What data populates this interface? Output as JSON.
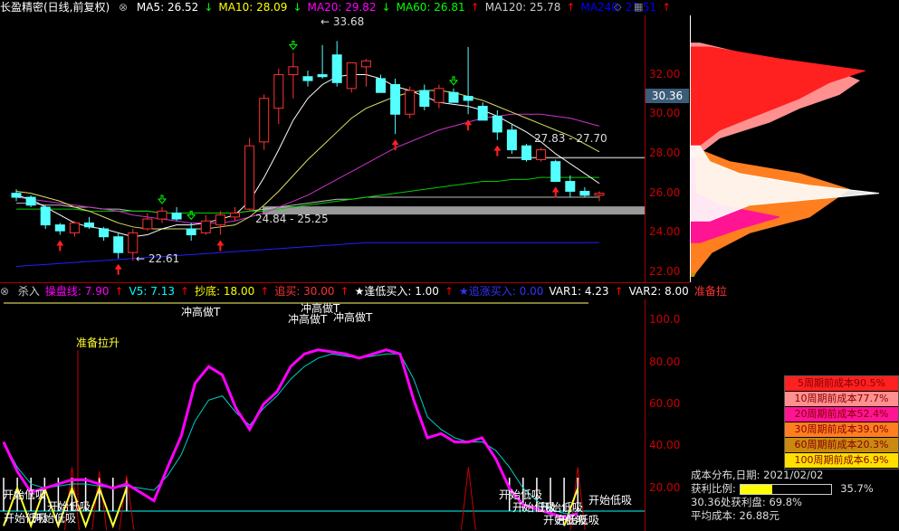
{
  "header": {
    "title": "长盈精密(日线,前复权)",
    "ma": [
      {
        "label": "MA5: 26.52",
        "arrow": "↓",
        "color": "#ffffff",
        "arrow_color": "#00ff00"
      },
      {
        "label": "MA10: 28.09",
        "arrow": "↓",
        "color": "#ffff00",
        "arrow_color": "#00ff00"
      },
      {
        "label": "MA20: 29.82",
        "arrow": "↓",
        "color": "#ff00ff",
        "arrow_color": "#00ff00"
      },
      {
        "label": "MA60: 26.81",
        "arrow": "↑",
        "color": "#00ff00",
        "arrow_color": "#ff0000"
      },
      {
        "label": "MA120: 25.78",
        "arrow": "↑",
        "color": "#cccccc",
        "arrow_color": "#ff0000"
      },
      {
        "label": "MA240: 23.51",
        "arrow": "↑",
        "color": "#0000ff",
        "arrow_color": "#ff0000"
      }
    ]
  },
  "indicator_header": {
    "items": [
      {
        "label": "杀入",
        "color": "#cccccc"
      },
      {
        "label": "操盘线: 7.90",
        "color": "#ff00ff",
        "arrow": "↑",
        "arrow_color": "#ff0000"
      },
      {
        "label": "V5: 7.13",
        "color": "#00ffff",
        "arrow": "↑",
        "arrow_color": "#ff0000"
      },
      {
        "label": "抄底: 18.00",
        "color": "#ffff00",
        "arrow": "↑",
        "arrow_color": "#ff0000"
      },
      {
        "label": "追买: 30.00",
        "color": "#ff3333",
        "arrow": "↑",
        "arrow_color": "#ff0000"
      },
      {
        "label": "★逢低买入: 1.00",
        "color": "#ffffff",
        "arrow": "↑",
        "arrow_color": "#ff0000"
      },
      {
        "label": "★追涨买入: 0.00",
        "color": "#3333ff",
        "arrow": "",
        "arrow_color": "#ff0000"
      },
      {
        "label": "VAR1: 4.23",
        "color": "#ffffff",
        "arrow": "↑",
        "arrow_color": "#ff0000"
      },
      {
        "label": "VAR2: 8.00",
        "color": "#ffffff",
        "arrow": "",
        "arrow_color": "#ff0000"
      },
      {
        "label": "准备拉",
        "color": "#ff3333",
        "arrow": "",
        "arrow_color": "#ff0000"
      }
    ]
  },
  "price_axis": [
    "32.00",
    "30.00",
    "28.00",
    "26.00",
    "24.00",
    "22.00"
  ],
  "current_price": "30.36",
  "indicator_axis": [
    "100.0",
    "80.00",
    "60.00",
    "40.00",
    "20.00"
  ],
  "annotations": {
    "high": "33.68",
    "low": "22.61",
    "band_upper": "27.83 - 27.70",
    "band_lower": "24.84 - 25.25",
    "tall": [
      "冲高做T",
      "冲高做T",
      "冲高做T",
      "冲高做T"
    ],
    "ready": "准备拉升",
    "bottom": "开始低吸"
  },
  "chart_data": {
    "type": "candlestick",
    "candles": [
      [
        26.0,
        26.2,
        25.6,
        25.8
      ],
      [
        25.8,
        25.9,
        25.3,
        25.4
      ],
      [
        25.3,
        25.4,
        24.2,
        24.4
      ],
      [
        24.4,
        24.5,
        23.9,
        24.1
      ],
      [
        24.0,
        24.6,
        23.8,
        24.5
      ],
      [
        24.5,
        24.8,
        24.2,
        24.3
      ],
      [
        24.2,
        24.3,
        23.6,
        23.8
      ],
      [
        23.8,
        24.0,
        22.7,
        23.0
      ],
      [
        23.0,
        24.2,
        22.6,
        24.0
      ],
      [
        24.2,
        25.0,
        24.1,
        24.7
      ],
      [
        24.7,
        25.3,
        24.5,
        25.1
      ],
      [
        25.0,
        25.3,
        24.6,
        24.7
      ],
      [
        24.2,
        24.5,
        23.6,
        23.9
      ],
      [
        24.0,
        24.9,
        23.9,
        24.6
      ],
      [
        24.4,
        25.1,
        23.9,
        24.9
      ],
      [
        24.8,
        25.3,
        24.6,
        25.0
      ],
      [
        25.2,
        28.8,
        25.1,
        28.4
      ],
      [
        28.6,
        31.0,
        28.2,
        30.8
      ],
      [
        30.3,
        32.3,
        29.5,
        32.0
      ],
      [
        32.0,
        33.1,
        30.8,
        32.4
      ],
      [
        31.9,
        32.2,
        31.4,
        31.7
      ],
      [
        32.0,
        33.5,
        31.8,
        31.9
      ],
      [
        33.0,
        33.7,
        31.4,
        31.6
      ],
      [
        31.3,
        32.1,
        31.1,
        32.6
      ],
      [
        32.4,
        32.8,
        31.4,
        32.7
      ],
      [
        31.8,
        32.0,
        31.2,
        31.1
      ],
      [
        31.5,
        31.8,
        29.0,
        30.0
      ],
      [
        30.0,
        31.4,
        29.8,
        31.2
      ],
      [
        31.2,
        31.5,
        30.2,
        30.4
      ],
      [
        30.6,
        31.5,
        30.3,
        31.3
      ],
      [
        31.1,
        31.3,
        30.6,
        30.6
      ],
      [
        30.9,
        33.4,
        30.0,
        30.7
      ],
      [
        30.4,
        30.6,
        29.7,
        29.7
      ],
      [
        29.9,
        30.2,
        28.7,
        29.1
      ],
      [
        29.2,
        29.5,
        28.0,
        28.2
      ],
      [
        28.4,
        28.5,
        27.6,
        27.7
      ],
      [
        27.7,
        28.3,
        27.6,
        28.2
      ],
      [
        27.6,
        27.7,
        26.6,
        26.6
      ],
      [
        26.6,
        26.9,
        25.8,
        26.1
      ],
      [
        26.1,
        26.3,
        25.8,
        25.9
      ],
      [
        25.9,
        26.1,
        25.6,
        26.0
      ]
    ],
    "ma5": [
      25.9,
      25.7,
      25.3,
      24.9,
      24.5,
      24.3,
      24.2,
      24.0,
      23.8,
      23.9,
      24.2,
      24.4,
      24.4,
      24.5,
      24.7,
      24.9,
      25.6,
      26.8,
      28.2,
      29.7,
      30.8,
      31.5,
      31.9,
      32.0,
      32.0,
      31.8,
      31.4,
      31.2,
      30.9,
      30.6,
      30.5,
      30.4,
      30.2,
      29.9,
      29.5,
      29.1,
      28.6,
      28.0,
      27.5,
      27.0,
      26.5
    ],
    "ma10": [
      26.1,
      26.0,
      25.8,
      25.6,
      25.3,
      25.1,
      24.8,
      24.5,
      24.3,
      24.2,
      24.2,
      24.2,
      24.2,
      24.2,
      24.3,
      24.4,
      24.8,
      25.4,
      26.1,
      26.9,
      27.7,
      28.4,
      29.1,
      29.8,
      30.3,
      30.6,
      30.9,
      31.1,
      31.2,
      31.2,
      31.1,
      30.9,
      30.7,
      30.4,
      30.1,
      29.8,
      29.5,
      29.2,
      28.9,
      28.5,
      28.1
    ],
    "ma20": [
      25.8,
      25.7,
      25.6,
      25.5,
      25.4,
      25.3,
      25.2,
      25.1,
      24.9,
      24.8,
      24.7,
      24.6,
      24.5,
      24.5,
      24.5,
      24.6,
      24.8,
      25.0,
      25.3,
      25.6,
      25.9,
      26.3,
      26.7,
      27.1,
      27.5,
      27.9,
      28.3,
      28.6,
      28.9,
      29.2,
      29.4,
      29.6,
      29.8,
      29.9,
      30.0,
      30.0,
      30.0,
      29.9,
      29.8,
      29.6,
      29.4
    ],
    "ma60": [
      25.2,
      25.2,
      25.2,
      25.2,
      25.2,
      25.1,
      25.1,
      25.1,
      25.1,
      25.1,
      25.0,
      25.0,
      25.0,
      25.0,
      25.0,
      25.0,
      25.1,
      25.1,
      25.2,
      25.3,
      25.4,
      25.5,
      25.6,
      25.7,
      25.8,
      25.9,
      26.0,
      26.1,
      26.2,
      26.3,
      26.4,
      26.5,
      26.6,
      26.6,
      26.7,
      26.7,
      26.8,
      26.8,
      26.8,
      26.8,
      26.8
    ],
    "ma120": [
      25.5,
      25.5,
      25.4,
      25.4,
      25.3,
      25.3,
      25.2,
      25.2,
      25.1,
      25.1,
      25.0,
      25.0,
      25.0,
      25.0,
      25.0,
      25.0,
      25.1,
      25.2,
      25.3,
      25.4,
      25.5,
      25.6,
      25.7,
      25.7,
      25.8,
      25.8,
      25.8,
      25.8,
      25.8,
      25.8,
      25.8,
      25.8,
      25.8,
      25.8,
      25.8,
      25.8,
      25.8,
      25.8,
      25.8,
      25.8,
      25.8
    ],
    "ma240": [
      22.3,
      22.35,
      22.4,
      22.45,
      22.5,
      22.55,
      22.6,
      22.65,
      22.7,
      22.75,
      22.8,
      22.85,
      22.9,
      22.95,
      23.0,
      23.05,
      23.1,
      23.15,
      23.2,
      23.25,
      23.3,
      23.35,
      23.4,
      23.45,
      23.5,
      23.5,
      23.5,
      23.5,
      23.5,
      23.5,
      23.5,
      23.5,
      23.5,
      23.5,
      23.5,
      23.5,
      23.5,
      23.5,
      23.5,
      23.5,
      23.51
    ],
    "xlim": [
      0,
      40
    ],
    "ylim": [
      21.5,
      35.0
    ]
  },
  "indicator_data": {
    "type": "line",
    "operating_line": [
      42,
      28,
      18,
      20,
      22,
      24,
      24,
      22,
      20,
      22,
      18,
      14,
      30,
      45,
      70,
      78,
      74,
      58,
      48,
      60,
      66,
      78,
      84,
      86,
      85,
      84,
      82,
      84,
      86,
      84,
      62,
      44,
      46,
      42,
      42,
      44,
      34,
      20,
      12,
      10,
      8,
      6,
      7.9
    ],
    "v5": [
      42,
      30,
      22,
      20,
      21,
      22,
      22,
      21,
      20,
      21,
      20,
      19,
      26,
      36,
      52,
      62,
      64,
      56,
      50,
      58,
      64,
      72,
      78,
      82,
      84,
      83,
      82,
      83,
      84,
      84,
      72,
      54,
      48,
      44,
      42,
      42,
      38,
      30,
      20,
      14,
      10,
      8,
      7.13
    ],
    "ylim": [
      0,
      110
    ]
  },
  "distribution": {
    "date_label": "成本分布,日期: 2021/02/02",
    "profit_label": "获利比例:",
    "profit_value": "35.7%",
    "profit_fraction": 0.357,
    "profit_at_price": "30.36处获利盘: 69.8%",
    "avg_cost": "平均成本: 26.88元",
    "legend": [
      {
        "label": "5周期前成本90.5%",
        "color": "#ff2020"
      },
      {
        "label": "10周期前成本77.7%",
        "color": "#ff9090"
      },
      {
        "label": "20周期前成本52.4%",
        "color": "#ff1493"
      },
      {
        "label": "30周期前成本39.0%",
        "color": "#ff7f20"
      },
      {
        "label": "60周期前成本20.3%",
        "color": "#c88a10"
      },
      {
        "label": "100周期前成本6.9%",
        "color": "#ffe000"
      }
    ]
  }
}
